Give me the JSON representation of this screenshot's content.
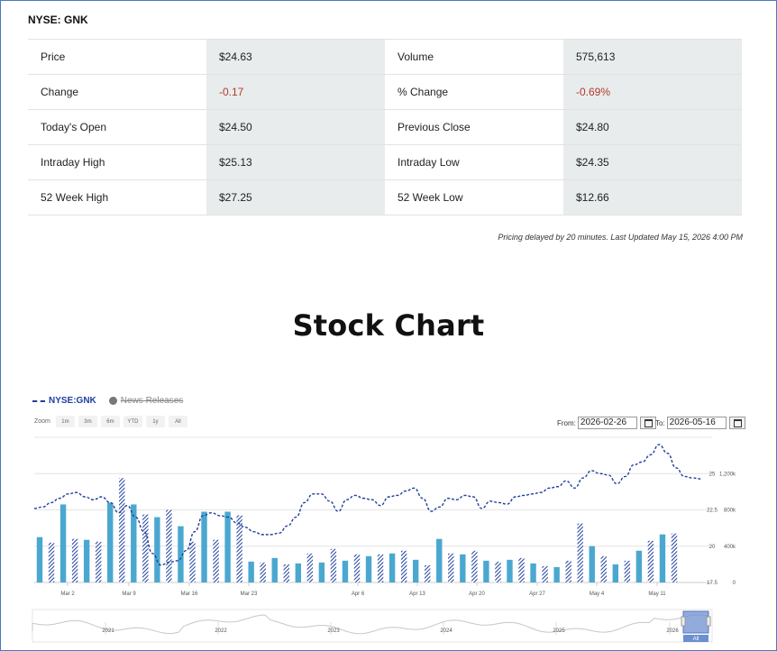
{
  "ticker": "NYSE: GNK",
  "quote_rows": [
    {
      "l1": "Price",
      "v1": "$24.63",
      "l2": "Volume",
      "v2": "575,613"
    },
    {
      "l1": "Change",
      "v1": "-0.17",
      "l2": "% Change",
      "v2": "-0.69%"
    },
    {
      "l1": "Today's Open",
      "v1": "$24.50",
      "l2": "Previous Close",
      "v2": "$24.80"
    },
    {
      "l1": "Intraday High",
      "v1": "$25.13",
      "l2": "Intraday Low",
      "v2": "$24.35"
    },
    {
      "l1": "52 Week High",
      "v1": "$27.25",
      "l2": "52 Week Low",
      "v2": "$12.66"
    }
  ],
  "delay_note": "Pricing delayed by 20 minutes. Last Updated May 15, 2026 4:00 PM",
  "section_title": "Stock Chart",
  "legend": {
    "series": "NYSE:GNK",
    "news": "News Releases"
  },
  "zoom": {
    "label": "Zoom",
    "buttons": [
      "1m",
      "3m",
      "6m",
      "YTD",
      "1y",
      "All"
    ]
  },
  "range": {
    "from_label": "From:",
    "from_value": "2026-02-26",
    "to_label": "To:",
    "to_value": "2026-05-16"
  },
  "colors": {
    "line": "#1f3f9e",
    "bar_up": "#4aa8d0",
    "bar_down": "#1f3f9e",
    "negative": "#b03a2e"
  },
  "chart_data": {
    "type": "line+bar",
    "price_axis": {
      "ticks": [
        17.5,
        20,
        22.5,
        25
      ],
      "range": [
        17.5,
        27.5
      ]
    },
    "volume_axis": {
      "ticks": [
        "0",
        "400k",
        "800k",
        "1,200k"
      ],
      "range": [
        0,
        1600000
      ]
    },
    "x_ticks": [
      "Mar 2",
      "Mar 9",
      "Mar 16",
      "Mar 23",
      "Apr 6",
      "Apr 13",
      "Apr 20",
      "Apr 27",
      "May 4",
      "May 11"
    ],
    "price": [
      22.6,
      22.7,
      23.0,
      23.3,
      23.6,
      23.7,
      23.4,
      23.2,
      23.4,
      23.0,
      22.3,
      22.8,
      22.0,
      21.0,
      19.5,
      18.7,
      18.9,
      19.0,
      19.7,
      21.0,
      22.1,
      22.3,
      22.1,
      22.0,
      21.6,
      21.3,
      21.0,
      20.8,
      20.8,
      20.9,
      21.4,
      22.0,
      23.0,
      23.6,
      23.6,
      23.1,
      22.4,
      23.2,
      23.5,
      23.3,
      23.2,
      22.8,
      23.4,
      23.5,
      23.8,
      24.0,
      23.3,
      22.4,
      22.7,
      23.3,
      23.2,
      23.5,
      23.4,
      22.6,
      23.1,
      23.0,
      22.9,
      23.4,
      23.5,
      23.6,
      23.7,
      24.0,
      24.1,
      24.5,
      24.0,
      24.7,
      25.2,
      25.0,
      24.9,
      24.3,
      24.8,
      25.6,
      25.8,
      26.3,
      27.0,
      26.4,
      25.4,
      24.8,
      24.7,
      24.63
    ],
    "volume": [
      500000,
      440000,
      860000,
      480000,
      470000,
      450000,
      880000,
      1150000,
      860000,
      750000,
      720000,
      800000,
      620000,
      450000,
      780000,
      470000,
      780000,
      740000,
      230000,
      220000,
      270000,
      200000,
      210000,
      320000,
      220000,
      370000,
      240000,
      310000,
      290000,
      310000,
      320000,
      350000,
      250000,
      190000,
      480000,
      320000,
      310000,
      350000,
      240000,
      230000,
      250000,
      270000,
      210000,
      180000,
      170000,
      240000,
      650000,
      400000,
      290000,
      200000,
      240000,
      350000,
      460000,
      530000,
      540000
    ],
    "volume_direction": [
      "up",
      "down",
      "up",
      "down",
      "up",
      "down",
      "up",
      "down",
      "up",
      "down",
      "up",
      "down",
      "up",
      "down",
      "up",
      "down",
      "up",
      "down",
      "up",
      "down",
      "up",
      "down",
      "up",
      "down",
      "up",
      "down",
      "up",
      "down",
      "up",
      "down",
      "up",
      "down",
      "up",
      "down",
      "up",
      "down",
      "up",
      "down",
      "up",
      "down",
      "up",
      "down",
      "up",
      "down",
      "up",
      "down",
      "down",
      "up",
      "down",
      "up",
      "down",
      "up",
      "down",
      "up",
      "down"
    ],
    "navigator_years": [
      "2021",
      "2022",
      "2023",
      "2024",
      "2025",
      "2026"
    ],
    "navigator_label": "All"
  }
}
